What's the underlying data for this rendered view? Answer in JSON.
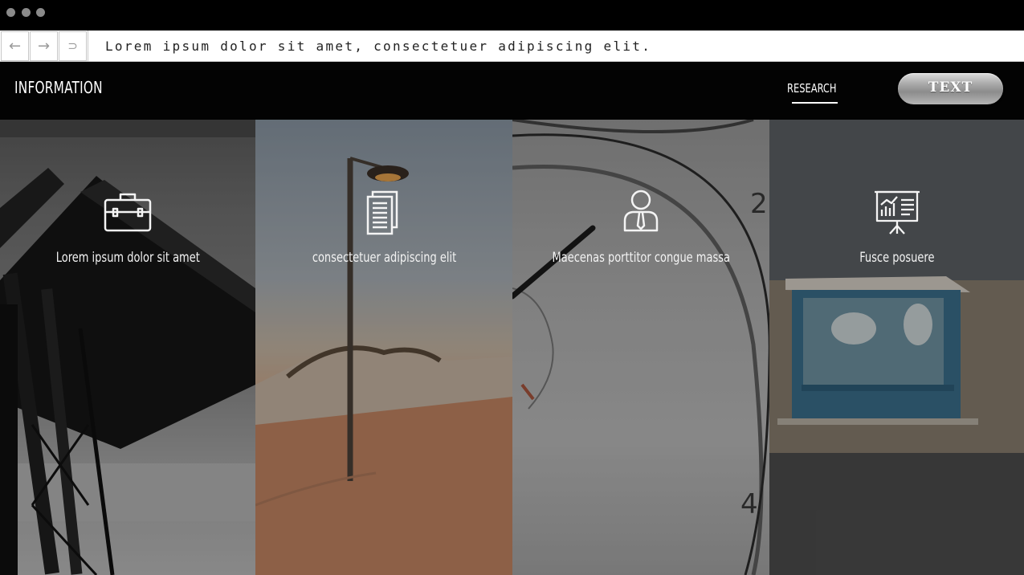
{
  "window": {
    "address": "Lorem ipsum dolor sit amet, consectetuer adipiscing elit.",
    "nav": {
      "back_glyph": "←",
      "forward_glyph": "→",
      "reload_glyph": "⊃"
    }
  },
  "header": {
    "logo": "INFORMATION",
    "nav_link": "RESEARCH",
    "button": "TEXT"
  },
  "panels": [
    {
      "label": "Lorem ipsum dolor sit amet",
      "icon": "briefcase-icon"
    },
    {
      "label": "consectetuer adipiscing elit",
      "icon": "documents-icon"
    },
    {
      "label": "Maecenas porttitor congue massa",
      "icon": "businessman-icon"
    },
    {
      "label": "Fusce posuere",
      "icon": "presentation-chart-icon"
    }
  ],
  "photo_clock_numbers": [
    "2",
    "4"
  ]
}
